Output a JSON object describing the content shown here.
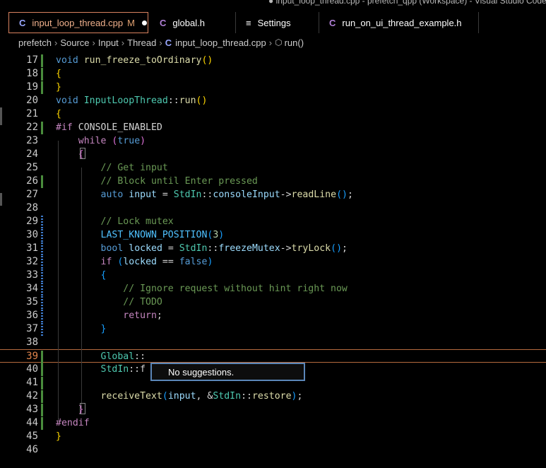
{
  "window": {
    "title": "● input_loop_thread.cpp - prefetch_qpp (Workspace) - Visual Studio Code"
  },
  "tabs": [
    {
      "icon": "C",
      "icon_name": "cpp-file-icon",
      "label": "input_loop_thread.cpp",
      "badge": "M",
      "dirty": true
    },
    {
      "icon": "C",
      "icon_name": "c-header-file-icon",
      "label": "global.h"
    },
    {
      "icon": "≡",
      "icon_name": "settings-icon",
      "label": "Settings"
    },
    {
      "icon": "C",
      "icon_name": "c-header-file-icon",
      "label": "run_on_ui_thread_example.h"
    }
  ],
  "breadcrumb": {
    "items": [
      "prefetch",
      "Source",
      "Input",
      "Thread"
    ],
    "file_icon": "C",
    "file": "input_loop_thread.cpp",
    "symbol_icon": "method-cube-icon",
    "symbol": "run()"
  },
  "editor": {
    "current_line": 39,
    "lines": [
      {
        "n": "17",
        "gutter": "add",
        "tokens": [
          [
            "kw",
            "void"
          ],
          [
            "pl",
            " "
          ],
          [
            "fn",
            "run_freeze_toOrdinary"
          ],
          [
            "br1",
            "()"
          ]
        ]
      },
      {
        "n": "18",
        "gutter": "add",
        "tokens": [
          [
            "br1",
            "{"
          ]
        ]
      },
      {
        "n": "19",
        "gutter": "add",
        "tokens": [
          [
            "br1",
            "}"
          ]
        ]
      },
      {
        "n": "20",
        "gutter": "",
        "tokens": [
          [
            "kw",
            "void"
          ],
          [
            "pl",
            " "
          ],
          [
            "ty",
            "InputLoopThread"
          ],
          [
            "pl",
            "::"
          ],
          [
            "fn",
            "run"
          ],
          [
            "br1",
            "()"
          ]
        ]
      },
      {
        "n": "21",
        "gutter": "",
        "tokens": [
          [
            "br1",
            "{"
          ]
        ]
      },
      {
        "n": "22",
        "gutter": "add",
        "tokens": [
          [
            "pp",
            "#if"
          ],
          [
            "pl",
            " CONSOLE_ENABLED"
          ]
        ]
      },
      {
        "n": "23",
        "gutter": "",
        "tokens": [
          [
            "pl",
            "    "
          ],
          [
            "pp",
            "while"
          ],
          [
            "pl",
            " "
          ],
          [
            "br2",
            "("
          ],
          [
            "kw",
            "true"
          ],
          [
            "br2",
            ")"
          ]
        ]
      },
      {
        "n": "24",
        "gutter": "",
        "tokens": [
          [
            "pl",
            "    "
          ],
          [
            "br2",
            "{"
          ]
        ]
      },
      {
        "n": "25",
        "gutter": "",
        "tokens": [
          [
            "pl",
            "        "
          ],
          [
            "cm",
            "// Get input"
          ]
        ]
      },
      {
        "n": "26",
        "gutter": "add",
        "tokens": [
          [
            "pl",
            "        "
          ],
          [
            "cm",
            "// Block until Enter pressed"
          ]
        ]
      },
      {
        "n": "27",
        "gutter": "",
        "tokens": [
          [
            "pl",
            "        "
          ],
          [
            "kw",
            "auto"
          ],
          [
            "pl",
            " "
          ],
          [
            "id",
            "input"
          ],
          [
            "pl",
            " = "
          ],
          [
            "ty",
            "StdIn"
          ],
          [
            "pl",
            "::"
          ],
          [
            "id",
            "consoleInput"
          ],
          [
            "pl",
            "->"
          ],
          [
            "fn",
            "readLine"
          ],
          [
            "br3",
            "()"
          ],
          [
            "pl",
            ";"
          ]
        ]
      },
      {
        "n": "28",
        "gutter": "",
        "tokens": []
      },
      {
        "n": "29",
        "gutter": "mod",
        "tokens": [
          [
            "pl",
            "        "
          ],
          [
            "cm",
            "// Lock mutex"
          ]
        ]
      },
      {
        "n": "30",
        "gutter": "mod",
        "tokens": [
          [
            "pl",
            "        "
          ],
          [
            "def",
            "LAST_KNOWN_POSITION"
          ],
          [
            "br3",
            "("
          ],
          [
            "num",
            "3"
          ],
          [
            "br3",
            ")"
          ]
        ]
      },
      {
        "n": "31",
        "gutter": "mod",
        "tokens": [
          [
            "pl",
            "        "
          ],
          [
            "kw",
            "bool"
          ],
          [
            "pl",
            " "
          ],
          [
            "id",
            "locked"
          ],
          [
            "pl",
            " = "
          ],
          [
            "ty",
            "StdIn"
          ],
          [
            "pl",
            "::"
          ],
          [
            "id",
            "freezeMutex"
          ],
          [
            "pl",
            "->"
          ],
          [
            "fn",
            "tryLock"
          ],
          [
            "br3",
            "()"
          ],
          [
            "pl",
            ";"
          ]
        ]
      },
      {
        "n": "32",
        "gutter": "mod",
        "tokens": [
          [
            "pl",
            "        "
          ],
          [
            "ret",
            "if"
          ],
          [
            "pl",
            " "
          ],
          [
            "br3",
            "("
          ],
          [
            "id",
            "locked"
          ],
          [
            "pl",
            " == "
          ],
          [
            "kw",
            "false"
          ],
          [
            "br3",
            ")"
          ]
        ]
      },
      {
        "n": "33",
        "gutter": "mod",
        "tokens": [
          [
            "pl",
            "        "
          ],
          [
            "br3",
            "{"
          ]
        ]
      },
      {
        "n": "34",
        "gutter": "mod",
        "tokens": [
          [
            "pl",
            "            "
          ],
          [
            "cm",
            "// Ignore request without hint right now"
          ]
        ]
      },
      {
        "n": "35",
        "gutter": "mod",
        "tokens": [
          [
            "pl",
            "            "
          ],
          [
            "cm",
            "// TODO"
          ]
        ]
      },
      {
        "n": "36",
        "gutter": "mod",
        "tokens": [
          [
            "pl",
            "            "
          ],
          [
            "ret",
            "return"
          ],
          [
            "pl",
            ";"
          ]
        ]
      },
      {
        "n": "37",
        "gutter": "mod",
        "tokens": [
          [
            "pl",
            "        "
          ],
          [
            "br3",
            "}"
          ]
        ]
      },
      {
        "n": "38",
        "gutter": "",
        "tokens": []
      },
      {
        "n": "39",
        "gutter": "add",
        "tokens": [
          [
            "pl",
            "        "
          ],
          [
            "ty",
            "Global"
          ],
          [
            "pl",
            "::"
          ]
        ]
      },
      {
        "n": "40",
        "gutter": "add",
        "tokens": [
          [
            "pl",
            "        "
          ],
          [
            "ty",
            "StdIn"
          ],
          [
            "pl",
            "::f"
          ]
        ]
      },
      {
        "n": "41",
        "gutter": "add",
        "tokens": []
      },
      {
        "n": "42",
        "gutter": "add",
        "tokens": [
          [
            "pl",
            "        "
          ],
          [
            "fn",
            "receiveText"
          ],
          [
            "br3",
            "("
          ],
          [
            "id",
            "input"
          ],
          [
            "pl",
            ", &"
          ],
          [
            "ty",
            "StdIn"
          ],
          [
            "pl",
            "::"
          ],
          [
            "fn",
            "restore"
          ],
          [
            "br3",
            ")"
          ],
          [
            "pl",
            ";"
          ]
        ]
      },
      {
        "n": "43",
        "gutter": "add",
        "tokens": [
          [
            "pl",
            "    "
          ],
          [
            "br2",
            "}"
          ]
        ]
      },
      {
        "n": "44",
        "gutter": "add",
        "tokens": [
          [
            "pp",
            "#endif"
          ]
        ]
      },
      {
        "n": "45",
        "gutter": "",
        "tokens": [
          [
            "br1",
            "}"
          ]
        ]
      },
      {
        "n": "46",
        "gutter": "",
        "tokens": []
      }
    ]
  },
  "suggest_widget": {
    "message": "No suggestions."
  }
}
